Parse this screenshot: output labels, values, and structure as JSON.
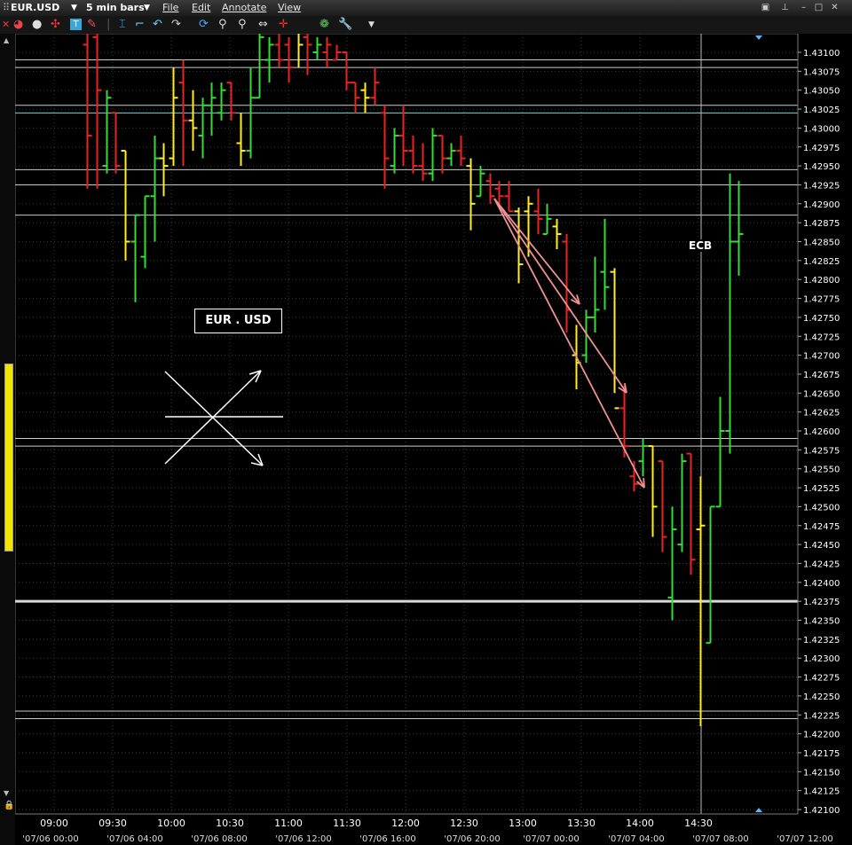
{
  "window": {
    "symbol": "EUR.USD",
    "timeframe": "5 min bars",
    "menus": [
      "File",
      "Edit",
      "Annotate",
      "View"
    ]
  },
  "icons": [
    "close-icon",
    "pie-icon",
    "circle-icon",
    "crosshair-icon",
    "text-tool-icon",
    "pencil-icon",
    "separator",
    "cursor-icon",
    "undo-icon",
    "redo-icon",
    "refresh-icon",
    "zoom-in-icon",
    "zoom-out-icon",
    "pan-icon",
    "crosshair-red-icon",
    "palette-icon",
    "wrench-icon",
    "dropdown-icon"
  ],
  "annotations": {
    "label_box": "EUR . USD",
    "ecb": "ECB"
  },
  "chart_data": {
    "type": "ohlc",
    "title": "EUR.USD",
    "ylim": [
      1.421,
      1.431
    ],
    "y_ticks": [
      "1.43100",
      "1.43075",
      "1.43050",
      "1.43025",
      "1.43000",
      "1.42975",
      "1.42950",
      "1.42925",
      "1.42900",
      "1.42875",
      "1.42850",
      "1.42825",
      "1.42800",
      "1.42775",
      "1.42750",
      "1.42725",
      "1.42700",
      "1.42675",
      "1.42650",
      "1.42625",
      "1.42600",
      "1.42575",
      "1.42550",
      "1.42525",
      "1.42500",
      "1.42475",
      "1.42450",
      "1.42425",
      "1.42400",
      "1.42375",
      "1.42350",
      "1.42325",
      "1.42300",
      "1.42275",
      "1.42250",
      "1.42225",
      "1.42200",
      "1.42175",
      "1.42150",
      "1.42125",
      "1.42100"
    ],
    "x_ticks_time": [
      "09:00",
      "09:30",
      "10:00",
      "10:30",
      "11:00",
      "11:30",
      "12:00",
      "12:30",
      "13:00",
      "13:30",
      "14:00",
      "14:30"
    ],
    "x_ticks_date": [
      "'07/06 00:00",
      "'07/06 04:00",
      "'07/06 08:00",
      "'07/06 12:00",
      "'07/06 16:00",
      "'07/06 20:00",
      "'07/07 00:00",
      "'07/07 04:00",
      "'07/07 08:00",
      "'07/07 12:00"
    ],
    "hlines": [
      1.4309,
      1.4308,
      1.4303,
      1.4302,
      1.42945,
      1.42925,
      1.42885,
      1.4259,
      1.4258,
      1.42375,
      1.4223,
      1.4222
    ],
    "colors": {
      "up": "#33dd33",
      "down": "#ee2222",
      "neutral": "#ffee22",
      "hline": "#cccccc",
      "hline_teal": "#7fd4d4",
      "arrow": "#f09090"
    },
    "bars": [
      {
        "h": 1.4316,
        "l": 1.4292,
        "o": 1.4311,
        "c": 1.4299,
        "col": "down"
      },
      {
        "h": 1.4314,
        "l": 1.4292,
        "o": 1.4312,
        "c": 1.4305,
        "col": "down"
      },
      {
        "h": 1.4305,
        "l": 1.4294,
        "o": 1.4295,
        "c": 1.4304,
        "col": "up"
      },
      {
        "h": 1.4302,
        "l": 1.4294,
        "o": 1.4302,
        "c": 1.4295,
        "col": "down"
      },
      {
        "h": 1.4297,
        "l": 1.42825,
        "o": 1.4297,
        "c": 1.4285,
        "col": "neutral"
      },
      {
        "h": 1.42885,
        "l": 1.4277,
        "o": 1.4285,
        "c": 1.42885,
        "col": "up"
      },
      {
        "h": 1.4291,
        "l": 1.42815,
        "o": 1.4283,
        "c": 1.4291,
        "col": "up"
      },
      {
        "h": 1.4299,
        "l": 1.4285,
        "o": 1.4291,
        "c": 1.4296,
        "col": "up"
      },
      {
        "h": 1.4298,
        "l": 1.4291,
        "o": 1.4296,
        "c": 1.4295,
        "col": "neutral"
      },
      {
        "h": 1.4308,
        "l": 1.4295,
        "o": 1.4296,
        "c": 1.4304,
        "col": "neutral"
      },
      {
        "h": 1.4309,
        "l": 1.4295,
        "o": 1.4306,
        "c": 1.4301,
        "col": "down"
      },
      {
        "h": 1.4305,
        "l": 1.4297,
        "o": 1.4301,
        "c": 1.43,
        "col": "neutral"
      },
      {
        "h": 1.4304,
        "l": 1.4296,
        "o": 1.4299,
        "c": 1.4303,
        "col": "up"
      },
      {
        "h": 1.4306,
        "l": 1.4299,
        "o": 1.4303,
        "c": 1.4304,
        "col": "up"
      },
      {
        "h": 1.4306,
        "l": 1.4301,
        "o": 1.4302,
        "c": 1.4305,
        "col": "up"
      },
      {
        "h": 1.4306,
        "l": 1.4301,
        "o": 1.4306,
        "c": 1.4302,
        "col": "down"
      },
      {
        "h": 1.4302,
        "l": 1.4295,
        "o": 1.4298,
        "c": 1.4297,
        "col": "neutral"
      },
      {
        "h": 1.4308,
        "l": 1.4296,
        "o": 1.4297,
        "c": 1.4304,
        "col": "up"
      },
      {
        "h": 1.4314,
        "l": 1.4304,
        "o": 1.4304,
        "c": 1.4312,
        "col": "up"
      },
      {
        "h": 1.4312,
        "l": 1.4306,
        "o": 1.4309,
        "c": 1.4311,
        "col": "up"
      },
      {
        "h": 1.4313,
        "l": 1.4308,
        "o": 1.4311,
        "c": 1.4309,
        "col": "down"
      },
      {
        "h": 1.4312,
        "l": 1.4306,
        "o": 1.4311,
        "c": 1.4308,
        "col": "down"
      },
      {
        "h": 1.4314,
        "l": 1.4308,
        "o": 1.4313,
        "c": 1.4311,
        "col": "neutral"
      },
      {
        "h": 1.4313,
        "l": 1.4307,
        "o": 1.4312,
        "c": 1.4311,
        "col": "down"
      },
      {
        "h": 1.4312,
        "l": 1.4309,
        "o": 1.431,
        "c": 1.4311,
        "col": "up"
      },
      {
        "h": 1.4312,
        "l": 1.4308,
        "o": 1.431,
        "c": 1.4311,
        "col": "down"
      },
      {
        "h": 1.4311,
        "l": 1.4309,
        "o": 1.4309,
        "c": 1.431,
        "col": "down"
      },
      {
        "h": 1.431,
        "l": 1.4305,
        "o": 1.431,
        "c": 1.4306,
        "col": "down"
      },
      {
        "h": 1.4306,
        "l": 1.4302,
        "o": 1.4306,
        "c": 1.4304,
        "col": "down"
      },
      {
        "h": 1.4306,
        "l": 1.4302,
        "o": 1.4305,
        "c": 1.4304,
        "col": "neutral"
      },
      {
        "h": 1.4308,
        "l": 1.4303,
        "o": 1.4304,
        "c": 1.4306,
        "col": "down"
      },
      {
        "h": 1.4303,
        "l": 1.4292,
        "o": 1.4302,
        "c": 1.4296,
        "col": "down"
      },
      {
        "h": 1.43,
        "l": 1.4294,
        "o": 1.4295,
        "c": 1.4299,
        "col": "up"
      },
      {
        "h": 1.4303,
        "l": 1.4295,
        "o": 1.4299,
        "c": 1.4297,
        "col": "down"
      },
      {
        "h": 1.4299,
        "l": 1.4294,
        "o": 1.4297,
        "c": 1.4295,
        "col": "down"
      },
      {
        "h": 1.4298,
        "l": 1.4293,
        "o": 1.4295,
        "c": 1.4294,
        "col": "down"
      },
      {
        "h": 1.43,
        "l": 1.4293,
        "o": 1.4294,
        "c": 1.4299,
        "col": "up"
      },
      {
        "h": 1.4299,
        "l": 1.4294,
        "o": 1.4299,
        "c": 1.4296,
        "col": "down"
      },
      {
        "h": 1.4298,
        "l": 1.4295,
        "o": 1.4296,
        "c": 1.4297,
        "col": "up"
      },
      {
        "h": 1.4299,
        "l": 1.4295,
        "o": 1.4297,
        "c": 1.4296,
        "col": "down"
      },
      {
        "h": 1.4296,
        "l": 1.42865,
        "o": 1.4295,
        "c": 1.429,
        "col": "neutral"
      },
      {
        "h": 1.4295,
        "l": 1.4291,
        "o": 1.4291,
        "c": 1.4294,
        "col": "up"
      },
      {
        "h": 1.4294,
        "l": 1.429,
        "o": 1.4293,
        "c": 1.4291,
        "col": "down"
      },
      {
        "h": 1.4293,
        "l": 1.429,
        "o": 1.4292,
        "c": 1.4291,
        "col": "down"
      },
      {
        "h": 1.4293,
        "l": 1.4289,
        "o": 1.4291,
        "c": 1.4289,
        "col": "down"
      },
      {
        "h": 1.42895,
        "l": 1.42795,
        "o": 1.4289,
        "c": 1.4282,
        "col": "neutral"
      },
      {
        "h": 1.4291,
        "l": 1.4283,
        "o": 1.4289,
        "c": 1.429,
        "col": "neutral"
      },
      {
        "h": 1.4292,
        "l": 1.4286,
        "o": 1.4289,
        "c": 1.4288,
        "col": "down"
      },
      {
        "h": 1.429,
        "l": 1.4286,
        "o": 1.4286,
        "c": 1.4288,
        "col": "up"
      },
      {
        "h": 1.4288,
        "l": 1.4284,
        "o": 1.4287,
        "c": 1.4286,
        "col": "neutral"
      },
      {
        "h": 1.4286,
        "l": 1.4273,
        "o": 1.4285,
        "c": 1.4276,
        "col": "down"
      },
      {
        "h": 1.4274,
        "l": 1.42655,
        "o": 1.427,
        "c": 1.4269,
        "col": "neutral"
      },
      {
        "h": 1.4276,
        "l": 1.4269,
        "o": 1.427,
        "c": 1.4275,
        "col": "up"
      },
      {
        "h": 1.4283,
        "l": 1.4273,
        "o": 1.4275,
        "c": 1.4276,
        "col": "up"
      },
      {
        "h": 1.4288,
        "l": 1.4276,
        "o": 1.4281,
        "c": 1.4279,
        "col": "up"
      },
      {
        "h": 1.42815,
        "l": 1.4265,
        "o": 1.4281,
        "c": 1.4263,
        "col": "neutral"
      },
      {
        "h": 1.4266,
        "l": 1.42565,
        "o": 1.4263,
        "c": 1.4258,
        "col": "down"
      },
      {
        "h": 1.4256,
        "l": 1.4252,
        "o": 1.4254,
        "c": 1.4253,
        "col": "down"
      },
      {
        "h": 1.4259,
        "l": 1.4254,
        "o": 1.4256,
        "c": 1.4258,
        "col": "up"
      },
      {
        "h": 1.4258,
        "l": 1.4246,
        "o": 1.4258,
        "c": 1.425,
        "col": "neutral"
      },
      {
        "h": 1.4256,
        "l": 1.4244,
        "o": 1.4256,
        "c": 1.4246,
        "col": "down"
      },
      {
        "h": 1.425,
        "l": 1.4235,
        "o": 1.4238,
        "c": 1.4247,
        "col": "up"
      },
      {
        "h": 1.4257,
        "l": 1.4244,
        "o": 1.4245,
        "c": 1.4256,
        "col": "up"
      },
      {
        "h": 1.4257,
        "l": 1.4241,
        "o": 1.4257,
        "c": 1.4243,
        "col": "down"
      },
      {
        "h": 1.4254,
        "l": 1.4221,
        "o": 1.4247,
        "c": 1.42475,
        "col": "neutral"
      },
      {
        "h": 1.425,
        "l": 1.4232,
        "o": 1.4232,
        "c": 1.425,
        "col": "up"
      },
      {
        "h": 1.42645,
        "l": 1.425,
        "o": 1.425,
        "c": 1.426,
        "col": "up"
      },
      {
        "h": 1.4294,
        "l": 1.4257,
        "o": 1.426,
        "c": 1.4285,
        "col": "up"
      },
      {
        "h": 1.4293,
        "l": 1.42805,
        "o": 1.4285,
        "c": 1.4286,
        "col": "up"
      }
    ]
  }
}
